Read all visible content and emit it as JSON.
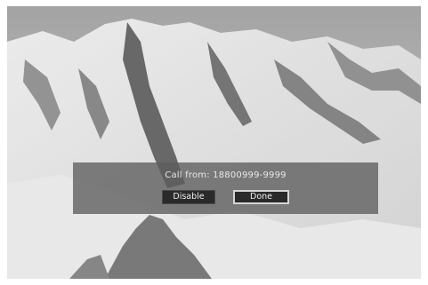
{
  "notification": {
    "message": "Call from: 18800999-9999",
    "disable_label": "Disable",
    "done_label": "Done",
    "focused_button": "Done"
  },
  "background": {
    "description_icon": "mountain-photo",
    "colors": {
      "sky": "#bdbdbd",
      "snow": "#e4e4e4",
      "rock": "#5a5a5a",
      "dialog": "#5c5c5c",
      "button": "#2a2a2a",
      "focus_border": "#d6d6d6"
    }
  }
}
